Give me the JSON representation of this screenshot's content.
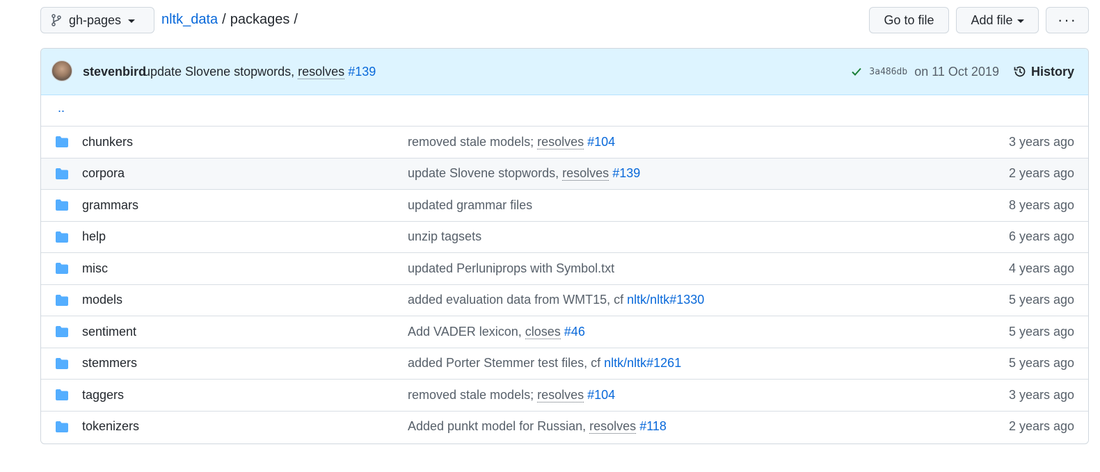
{
  "header": {
    "branch": "gh-pages",
    "breadcrumb": {
      "repo": "nltk_data",
      "sep1": "/",
      "dir": "packages",
      "sep2": "/"
    },
    "goto_file": "Go to file",
    "add_file": "Add file",
    "more": "···"
  },
  "commit": {
    "author": "stevenbird",
    "message": "update Slovene stopwords, ",
    "resolves": "resolves",
    "issue": "#139",
    "sha": "3a486db",
    "date": "on 11 Oct 2019",
    "history": "History"
  },
  "parent_link": "..",
  "rows": [
    {
      "name": "chunkers",
      "msg_pre": "removed stale models; ",
      "msg_kw": "resolves",
      "msg_issue": "#104",
      "msg_post": "",
      "age": "3 years ago"
    },
    {
      "name": "corpora",
      "msg_pre": "update Slovene stopwords, ",
      "msg_kw": "resolves",
      "msg_issue": "#139",
      "msg_post": "",
      "age": "2 years ago"
    },
    {
      "name": "grammars",
      "msg_pre": "updated grammar files",
      "msg_kw": "",
      "msg_issue": "",
      "msg_post": "",
      "age": "8 years ago"
    },
    {
      "name": "help",
      "msg_pre": "unzip tagsets",
      "msg_kw": "",
      "msg_issue": "",
      "msg_post": "",
      "age": "6 years ago"
    },
    {
      "name": "misc",
      "msg_pre": "updated Perluniprops with Symbol.txt",
      "msg_kw": "",
      "msg_issue": "",
      "msg_post": "",
      "age": "4 years ago"
    },
    {
      "name": "models",
      "msg_pre": "added evaluation data from WMT15, cf ",
      "msg_kw": "",
      "msg_issue": "nltk/nltk#1330",
      "msg_post": "",
      "age": "5 years ago"
    },
    {
      "name": "sentiment",
      "msg_pre": "Add VADER lexicon, ",
      "msg_kw": "closes",
      "msg_issue": "#46",
      "msg_post": "",
      "age": "5 years ago"
    },
    {
      "name": "stemmers",
      "msg_pre": "added Porter Stemmer test files, cf ",
      "msg_kw": "",
      "msg_issue": "nltk/nltk#1261",
      "msg_post": "",
      "age": "5 years ago"
    },
    {
      "name": "taggers",
      "msg_pre": "removed stale models; ",
      "msg_kw": "resolves",
      "msg_issue": "#104",
      "msg_post": "",
      "age": "3 years ago"
    },
    {
      "name": "tokenizers",
      "msg_pre": "Added punkt model for Russian, ",
      "msg_kw": "resolves",
      "msg_issue": "#118",
      "msg_post": "",
      "age": "2 years ago"
    }
  ],
  "colors": {
    "link": "#0969da",
    "folder": "#54aeff",
    "commit_bg": "#ddf4ff",
    "check": "#1a7f37"
  },
  "icons": {
    "branch": "git-branch-icon",
    "folder": "folder-icon",
    "check": "check-icon",
    "history": "clock-history-icon"
  }
}
